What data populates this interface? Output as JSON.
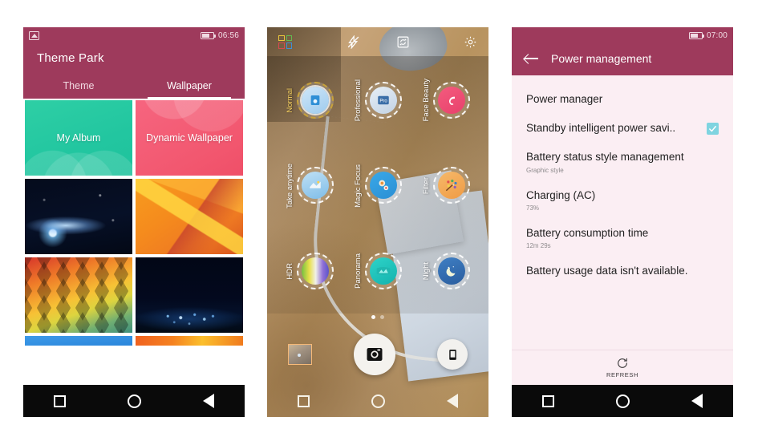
{
  "phone1": {
    "name": "theme-park",
    "statusbar": {
      "left_icon": "gallery-icon",
      "battery_icon": "battery-icon",
      "time": "06:56"
    },
    "app_title": "Theme Park",
    "tabs": [
      {
        "label": "Theme",
        "active": false
      },
      {
        "label": "Wallpaper",
        "active": true
      }
    ],
    "wallpapers": [
      {
        "label": "My Album",
        "art": "art-album"
      },
      {
        "label": "Dynamic Wallpaper",
        "art": "art-dynamic"
      },
      {
        "label": "",
        "art": "art-comet"
      },
      {
        "label": "",
        "art": "art-poly"
      },
      {
        "label": "",
        "art": "art-tri"
      },
      {
        "label": "",
        "art": "art-city"
      },
      {
        "label": "",
        "art": "art-blue"
      },
      {
        "label": "",
        "art": "art-sun"
      }
    ],
    "navbar": {
      "recents": "recents-button",
      "home": "home-button",
      "back": "back-button"
    },
    "accent_color": "#9e3a5c"
  },
  "phone2": {
    "name": "camera",
    "topbar": [
      {
        "icon": "mode-grid-icon",
        "label": ""
      },
      {
        "icon": "flash-off-icon",
        "label": ""
      },
      {
        "icon": "switch-camera-icon",
        "label": ""
      },
      {
        "icon": "settings-gear-icon",
        "label": ""
      }
    ],
    "modes": [
      {
        "label": "Normal",
        "selected": true,
        "bubble": "b-normal",
        "glyph": "◎"
      },
      {
        "label": "Professional",
        "selected": false,
        "bubble": "b-pro",
        "glyph": "Pro"
      },
      {
        "label": "Face Beauty",
        "selected": false,
        "bubble": "b-face",
        "glyph": "☺"
      },
      {
        "label": "Take anytime",
        "selected": false,
        "bubble": "b-anytime",
        "glyph": "△"
      },
      {
        "label": "Magic Focus",
        "selected": false,
        "bubble": "b-magic",
        "glyph": "●"
      },
      {
        "label": "Filter",
        "selected": false,
        "bubble": "b-filter",
        "glyph": "❁"
      },
      {
        "label": "HDR",
        "selected": false,
        "bubble": "b-hdr",
        "glyph": ""
      },
      {
        "label": "Panorama",
        "selected": false,
        "bubble": "b-pano",
        "glyph": "☰"
      },
      {
        "label": "Night",
        "selected": false,
        "bubble": "b-night",
        "glyph": "☽"
      }
    ],
    "page_dots": {
      "count": 2,
      "active_index": 0
    },
    "bottom": {
      "gallery_thumb": "gallery-thumbnail",
      "shutter": "shutter-button",
      "video": "video-record-button"
    },
    "navbar": {
      "recents": "recents-button",
      "home": "home-button",
      "back": "back-button"
    }
  },
  "phone3": {
    "name": "power-management",
    "statusbar": {
      "battery_icon": "battery-icon",
      "time": "07:00"
    },
    "appbar": {
      "back": "back-arrow",
      "title": "Power management"
    },
    "rows": [
      {
        "title": "Power manager",
        "sub": "",
        "checked": false
      },
      {
        "title": "Standby intelligent power savi..",
        "sub": "",
        "checked": true
      },
      {
        "title": "Battery status style management",
        "sub": "Graphic style",
        "checked": false
      },
      {
        "title": "Charging (AC)",
        "sub": "73%",
        "checked": false
      },
      {
        "title": "Battery consumption time",
        "sub": "12m 29s",
        "checked": false
      },
      {
        "title": "Battery usage data isn't available.",
        "sub": "",
        "checked": false
      }
    ],
    "footer": {
      "icon": "refresh-icon",
      "label": "REFRESH"
    },
    "navbar": {
      "recents": "recents-button",
      "home": "home-button",
      "back": "back-button"
    },
    "accent_color": "#9e3a5c",
    "checkbox_color": "#7fd4e0"
  }
}
